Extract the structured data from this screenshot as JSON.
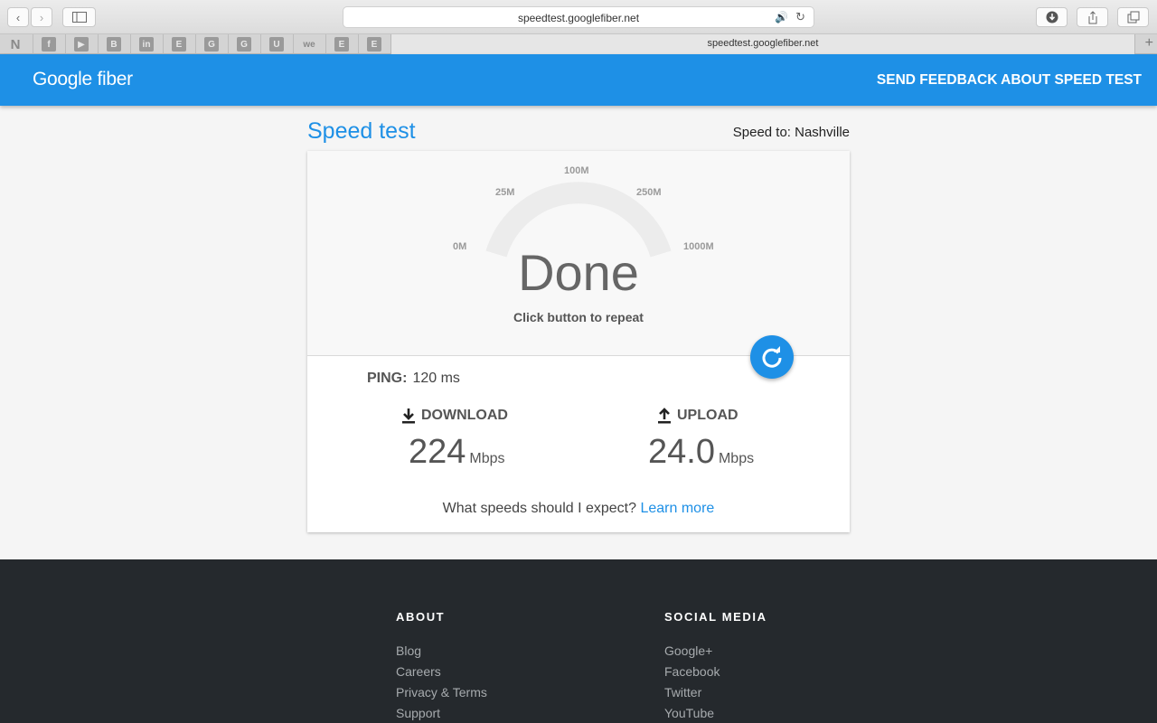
{
  "browser": {
    "url": "speedtest.googlefiber.net",
    "tab_title": "speedtest.googlefiber.net",
    "bookmarks": [
      "N",
      "f",
      "▶",
      "B",
      "in",
      "E",
      "G",
      "G",
      "U",
      "we",
      "E",
      "E"
    ]
  },
  "header": {
    "logo": "Google fiber",
    "feedback_label": "SEND FEEDBACK ABOUT SPEED TEST"
  },
  "main": {
    "title": "Speed test",
    "speed_to": "Speed to: Nashville",
    "gauge": {
      "ticks": [
        "0M",
        "25M",
        "100M",
        "250M",
        "1000M"
      ],
      "status": "Done",
      "hint": "Click button to repeat"
    },
    "ping": {
      "label": "PING:",
      "value": "120 ms"
    },
    "download": {
      "label": "DOWNLOAD",
      "value": "224",
      "unit": "Mbps"
    },
    "upload": {
      "label": "UPLOAD",
      "value": "24.0",
      "unit": "Mbps"
    },
    "expect_text": "What speeds should I expect?",
    "learn_more": "Learn more"
  },
  "footer": {
    "about": {
      "heading": "ABOUT",
      "links": [
        "Blog",
        "Careers",
        "Privacy & Terms",
        "Support"
      ]
    },
    "social": {
      "heading": "SOCIAL MEDIA",
      "links": [
        "Google+",
        "Facebook",
        "Twitter",
        "YouTube"
      ]
    }
  },
  "colors": {
    "brand": "#1e90e6",
    "footer_bg": "#25292d"
  }
}
